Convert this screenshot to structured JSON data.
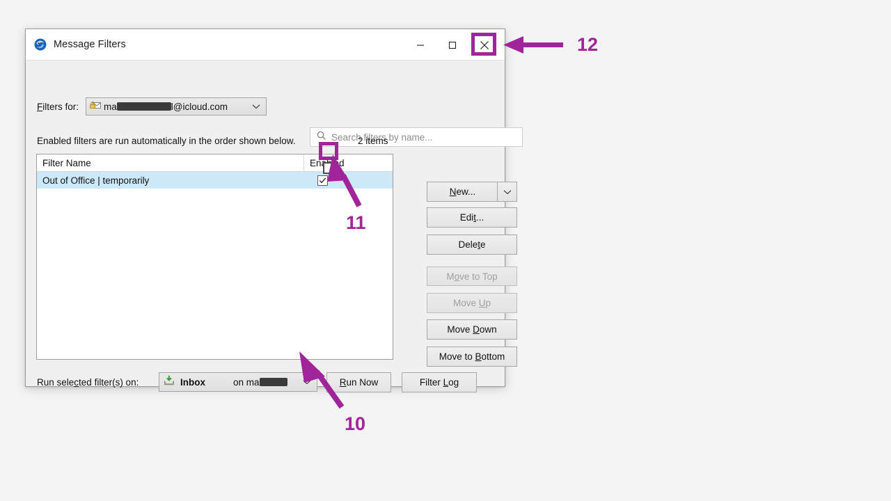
{
  "window": {
    "title": "Message Filters",
    "icon": "thunderbird-icon",
    "controls": {
      "minimize": "minimize-icon",
      "maximize": "maximize-icon",
      "close": "close-icon"
    }
  },
  "toolbar": {
    "filters_for_label": "Filters for:",
    "filters_for_accessor": "F",
    "account": {
      "icon": "locked-mail-icon",
      "prefix": "ma",
      "suffix": "l@icloud.com",
      "redacted": true
    },
    "search": {
      "icon": "search-icon",
      "placeholder": "Search filters by name...",
      "value": ""
    }
  },
  "info": {
    "hint": "Enabled filters are run automatically in the order shown below.",
    "item_count": "2 items"
  },
  "list": {
    "columns": [
      "Filter Name",
      "Enabled"
    ],
    "rows": [
      {
        "name": "Out of Office | temporarily",
        "enabled": true,
        "selected": true
      }
    ]
  },
  "buttons": {
    "new": {
      "label": "New...",
      "accessor": "N",
      "enabled": true
    },
    "new_dropdown": {
      "icon": "chevron-down-icon",
      "enabled": true
    },
    "edit": {
      "label": "Edit...",
      "accessor": "t",
      "enabled": true
    },
    "delete": {
      "label": "Delete",
      "accessor": "t",
      "enabled": true
    },
    "move_to_top": {
      "label": "Move to Top",
      "accessor": "o",
      "enabled": false
    },
    "move_up": {
      "label": "Move Up",
      "accessor": "U",
      "enabled": false
    },
    "move_down": {
      "label": "Move Down",
      "accessor": "D",
      "enabled": true
    },
    "move_to_bottom": {
      "label": "Move to Bottom",
      "accessor": "B",
      "enabled": true
    },
    "run_now": {
      "label": "Run Now",
      "accessor": "R",
      "enabled": true
    },
    "filter_log": {
      "label": "Filter Log",
      "accessor": "L",
      "enabled": true
    }
  },
  "run_row": {
    "label": "Run selected filter(s) on:",
    "folder": {
      "icon": "inbox-icon",
      "name": "Inbox",
      "account_prefix": "on ma",
      "redacted": true
    }
  },
  "annotations": {
    "accent_color": "#a0249a",
    "steps": [
      {
        "number": "10",
        "target": "folder-combo-chevron"
      },
      {
        "number": "11",
        "target": "enabled-checkbox"
      },
      {
        "number": "12",
        "target": "close-button"
      }
    ]
  }
}
